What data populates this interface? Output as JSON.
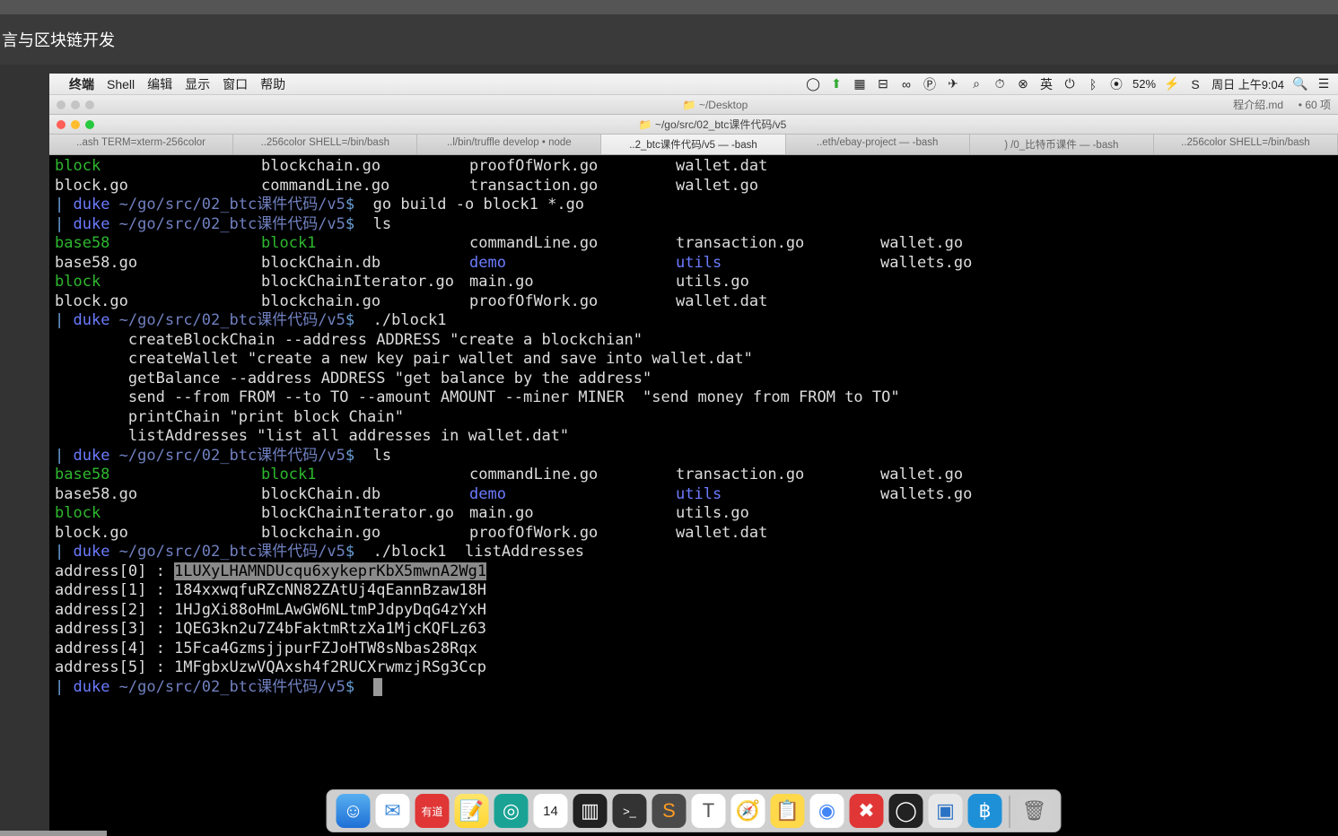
{
  "page_header": "言与区块链开发",
  "menubar": {
    "apple": "",
    "app_name": "终端",
    "items": [
      "Shell",
      "编辑",
      "显示",
      "窗口",
      "帮助"
    ],
    "status_battery": "52%",
    "status_time": "周日 上午9:04"
  },
  "finder_bar": {
    "path": "~/Desktop",
    "right1": "程介绍.md",
    "right2": "• 60 项"
  },
  "terminal_window": {
    "title": "~/go/src/02_btc课件代码/v5",
    "tabs": [
      "..ash TERM=xterm-256color",
      "..256color SHELL=/bin/bash",
      "..l/bin/truffle develop • node",
      "..2_btc课件代码/v5 — -bash",
      "..eth/ebay-project — -bash",
      ") /0_比特币课件 — -bash",
      "..256color SHELL=/bin/bash"
    ],
    "active_tab": 3
  },
  "prompt_user": "duke",
  "prompt_path": " ~/go/src/02_btc课件代码/v5",
  "prompt_symbol": "$",
  "listing1": {
    "rows": [
      [
        {
          "t": "block",
          "c": "green"
        },
        {
          "t": "blockchain.go",
          "c": "white"
        },
        {
          "t": "proofOfWork.go",
          "c": "white"
        },
        {
          "t": "wallet.dat",
          "c": "white"
        }
      ],
      [
        {
          "t": "block.go",
          "c": "white"
        },
        {
          "t": "commandLine.go",
          "c": "white"
        },
        {
          "t": "transaction.go",
          "c": "white"
        },
        {
          "t": "wallet.go",
          "c": "white"
        }
      ]
    ]
  },
  "cmd1": "go build -o block1 *.go",
  "cmd2": "ls",
  "listing2": {
    "rows": [
      [
        {
          "t": "base58",
          "c": "green"
        },
        {
          "t": "block1",
          "c": "green"
        },
        {
          "t": "commandLine.go",
          "c": "white"
        },
        {
          "t": "transaction.go",
          "c": "white"
        },
        {
          "t": "wallet.go",
          "c": "white"
        }
      ],
      [
        {
          "t": "base58.go",
          "c": "white"
        },
        {
          "t": "blockChain.db",
          "c": "white"
        },
        {
          "t": "demo",
          "c": "blue"
        },
        {
          "t": "utils",
          "c": "blue"
        },
        {
          "t": "wallets.go",
          "c": "white"
        }
      ],
      [
        {
          "t": "block",
          "c": "green"
        },
        {
          "t": "blockChainIterator.go",
          "c": "white"
        },
        {
          "t": "main.go",
          "c": "white"
        },
        {
          "t": "utils.go",
          "c": "white"
        }
      ],
      [
        {
          "t": "block.go",
          "c": "white"
        },
        {
          "t": "blockchain.go",
          "c": "white"
        },
        {
          "t": "proofOfWork.go",
          "c": "white"
        },
        {
          "t": "wallet.dat",
          "c": "white"
        }
      ]
    ]
  },
  "cmd3": " ./block1",
  "help_text": [
    "        createBlockChain --address ADDRESS \"create a blockchian\"",
    "        createWallet \"create a new key pair wallet and save into wallet.dat\"",
    "        getBalance --address ADDRESS \"get balance by the address\"",
    "        send --from FROM --to TO --amount AMOUNT --miner MINER  \"send money from FROM to TO\"",
    "        printChain \"print block Chain\"",
    "        listAddresses \"list all addresses in wallet.dat\""
  ],
  "cmd4": "ls",
  "cmd5": " ./block1  listAddresses",
  "addresses": [
    {
      "idx": "0",
      "val": "1LUXyLHAMNDUcqu6xykeprKbX5mwnA2Wg1",
      "sel": true
    },
    {
      "idx": "1",
      "val": "184xxwqfuRZcNN82ZAtUj4qEannBzaw18H"
    },
    {
      "idx": "2",
      "val": "1HJgXi88oHmLAwGW6NLtmPJdpyDqG4zYxH"
    },
    {
      "idx": "3",
      "val": "1QEG3kn2u7Z4bFaktmRtzXa1MjcKQFLz63"
    },
    {
      "idx": "4",
      "val": "15Fca4GzmsjjpurFZJoHTW8sNbas28Rqx"
    },
    {
      "idx": "5",
      "val": "1MFgbxUzwVQAxsh4f2RUCXrwmzjRSg3Ccp"
    }
  ],
  "dock_items": [
    {
      "name": "finder",
      "bg": "linear-gradient(#58b0f0,#1e6fd6)",
      "glyph": "☺"
    },
    {
      "name": "mail",
      "bg": "#fff",
      "glyph": "✉",
      "gcolor": "#3b88d8"
    },
    {
      "name": "youdao",
      "bg": "#e03636",
      "glyph": "有道",
      "fs": "12px"
    },
    {
      "name": "notes",
      "bg": "linear-gradient(#ffe56b,#ffd633)",
      "glyph": "📝"
    },
    {
      "name": "eye",
      "bg": "#1aa395",
      "glyph": "◎"
    },
    {
      "name": "calendar",
      "bg": "#fff",
      "glyph": "14",
      "gcolor": "#222",
      "fs": "15px"
    },
    {
      "name": "activity",
      "bg": "#222",
      "glyph": "▥"
    },
    {
      "name": "iterm",
      "bg": "#333",
      "glyph": ">_",
      "fs": "13px"
    },
    {
      "name": "sublime",
      "bg": "#4a4a4a",
      "glyph": "S",
      "gcolor": "#ff9b21"
    },
    {
      "name": "textedit",
      "bg": "#fff",
      "glyph": "T",
      "gcolor": "#555"
    },
    {
      "name": "safari",
      "bg": "#fff",
      "glyph": "🧭"
    },
    {
      "name": "sticky",
      "bg": "#ffd94a",
      "glyph": "📋"
    },
    {
      "name": "chrome",
      "bg": "#fff",
      "glyph": "◉",
      "gcolor": "#4285f4"
    },
    {
      "name": "xmind",
      "bg": "#e03636",
      "glyph": "✖"
    },
    {
      "name": "obs",
      "bg": "#222",
      "glyph": "◯"
    },
    {
      "name": "vmware",
      "bg": "#e8e8e8",
      "glyph": "▣",
      "gcolor": "#2b72c4"
    },
    {
      "name": "bitcoin",
      "bg": "#1e90d8",
      "glyph": "฿"
    },
    {
      "name": "trash",
      "bg": "#d0d0d0",
      "glyph": "🗑",
      "gcolor": "#666"
    }
  ]
}
